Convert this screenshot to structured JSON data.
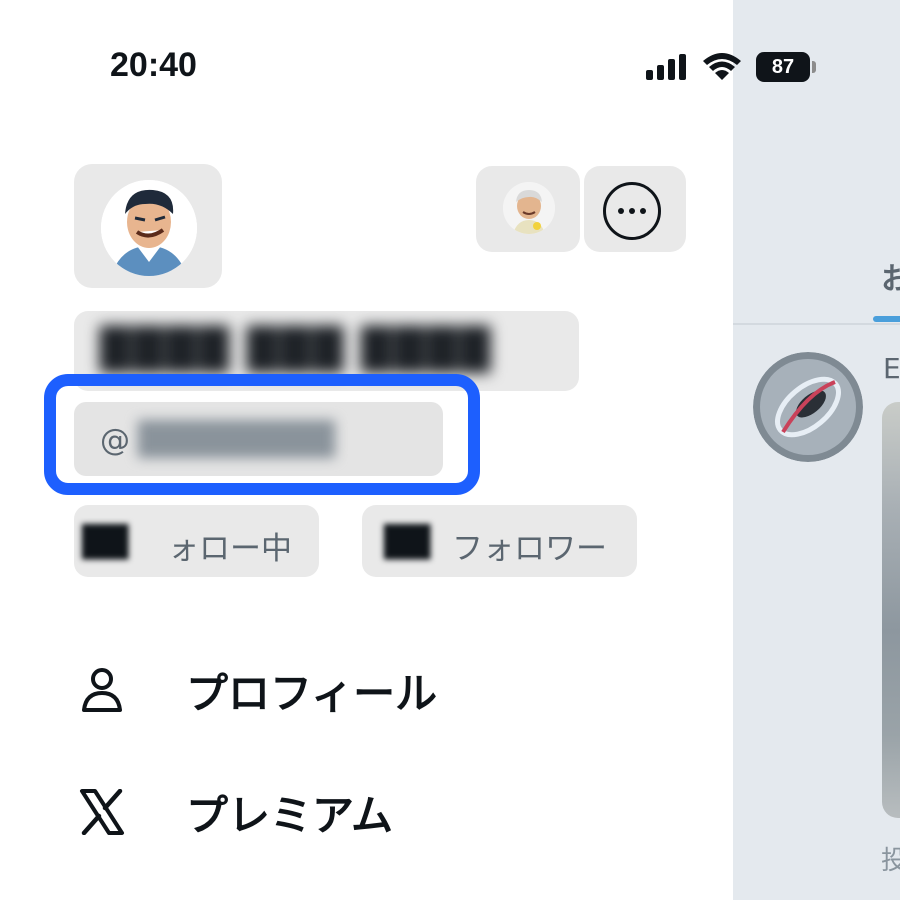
{
  "status_bar": {
    "time": "20:40",
    "battery": "87",
    "icons": [
      "signal-icon",
      "wifi-icon",
      "battery-icon"
    ]
  },
  "drawer": {
    "display_name": "████ ███ ████",
    "handle_prefix": "@",
    "handle": "████████",
    "following": {
      "count": "██",
      "label": "ォロー中"
    },
    "followers": {
      "count": "██",
      "label": "フォロワー"
    },
    "menu": [
      {
        "icon": "person-icon",
        "label": "プロフィール"
      },
      {
        "icon": "x-logo-icon",
        "label": "プレミアム"
      }
    ]
  },
  "timeline": {
    "tab_label": "お",
    "post_author": "E",
    "post_footer": "投"
  },
  "colors": {
    "highlight": "#1d5ffe",
    "chip_background": "#e9e9e9",
    "text": "#0f1419",
    "secondary_text": "#5b6670"
  }
}
